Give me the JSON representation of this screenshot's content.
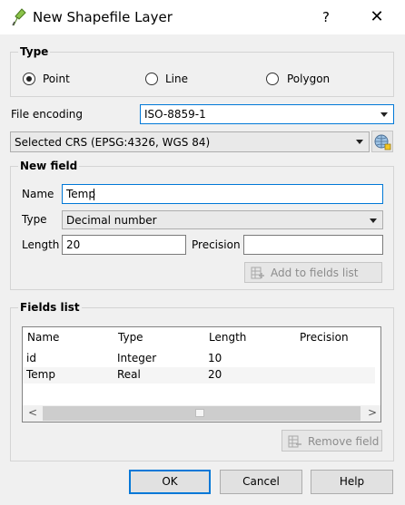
{
  "window": {
    "title": "New Shapefile Layer",
    "help_glyph": "?",
    "close_glyph": "✕"
  },
  "type_group": {
    "title": "Type",
    "options": [
      "Point",
      "Line",
      "Polygon"
    ],
    "selected": "Point"
  },
  "encoding": {
    "label": "File encoding",
    "value": "ISO-8859-1"
  },
  "crs": {
    "value": "Selected CRS (EPSG:4326, WGS 84)",
    "button_icon": "crs-globe-icon"
  },
  "new_field": {
    "title": "New field",
    "name_label": "Name",
    "name_value": "Temp",
    "type_label": "Type",
    "type_value": "Decimal number",
    "length_label": "Length",
    "length_value": "20",
    "precision_label": "Precision",
    "precision_value": "",
    "add_button": "Add to fields list"
  },
  "fields_list": {
    "title": "Fields list",
    "columns": [
      "Name",
      "Type",
      "Length",
      "Precision"
    ],
    "rows": [
      {
        "name": "id",
        "type": "Integer",
        "length": "10",
        "precision": ""
      },
      {
        "name": "Temp",
        "type": "Real",
        "length": "20",
        "precision": ""
      }
    ],
    "scroll_left": "<",
    "scroll_right": ">",
    "remove_button": "Remove field"
  },
  "buttons": {
    "ok": "OK",
    "cancel": "Cancel",
    "help": "Help"
  },
  "colors": {
    "accent": "#0078d7",
    "window_bg": "#f0f0f0"
  }
}
